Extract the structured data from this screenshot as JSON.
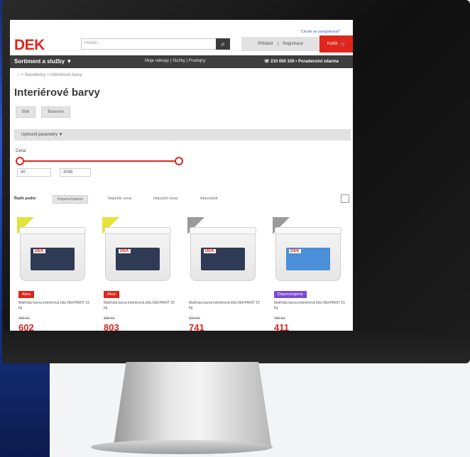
{
  "header": {
    "logo": "DEK",
    "search_placeholder": "Hledat...",
    "account_login": "Přihlásit",
    "account_register": "Registrace",
    "cart_label": "Košík",
    "top_link": "Chcete se zaregistrovat?"
  },
  "nav": {
    "main": "Sortiment a služby ▼",
    "links": "Moje nákupy  |  Služby  |  Prodejny",
    "phone": "☏ 210 000 100 • Poradenství zdarma"
  },
  "breadcrumb": "⌂  >  Stavebniny  >  Interiérové barvy",
  "page_title": "Interiérové barvy",
  "chips": [
    "Bílé",
    "Barevné"
  ],
  "filters": {
    "params_label": "Upřesnit parametry  ▼",
    "price_label": "Cena",
    "price_min": "40",
    "price_max": "3098"
  },
  "sort": {
    "label": "Řadit podle:",
    "options": [
      "Doporučujeme",
      "Nejnižší cena",
      "Nejvyšší cena",
      "Abecedně"
    ],
    "active_index": 0
  },
  "products": [
    {
      "tag": "Akce",
      "name": "Malířská barva interiérová bílá DEKPAINT 15 kg",
      "old_price": "699 Kč",
      "price": "602"
    },
    {
      "tag": "Akce",
      "name": "Malířská barva interiérová bílá DEKPAINT 25 kg",
      "old_price": "899 Kč",
      "price": "803"
    },
    {
      "tag": "",
      "name": "Malířská barva interiérová bílá DEKPAINT 15 kg",
      "old_price": "829 Kč",
      "price": "741"
    },
    {
      "tag": "Doporučujeme",
      "name": "Malířská barva interiérová bílá DEKPAINT 15 kg",
      "old_price": "489 Kč",
      "price": "411"
    }
  ],
  "colors": {
    "brand_red": "#e1251b",
    "nav_dark": "#3d3d3d",
    "tag_purple": "#7b4bd6",
    "badge_yellow": "#e6e23a"
  }
}
